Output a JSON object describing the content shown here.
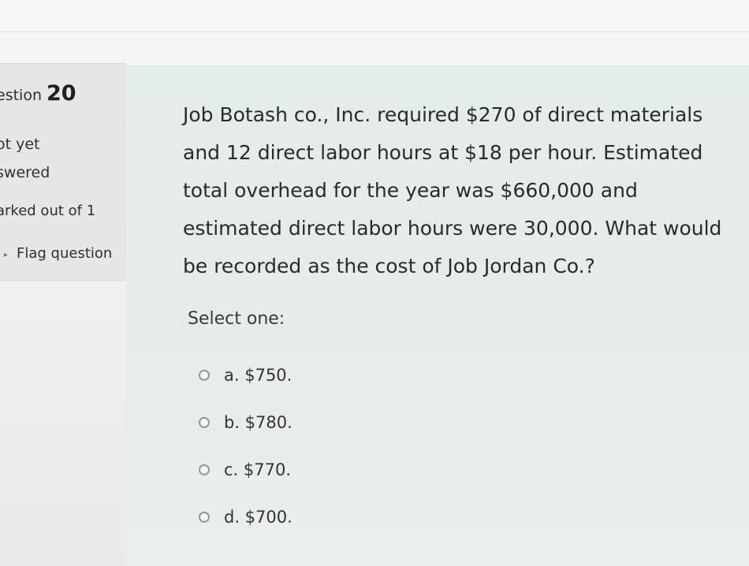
{
  "info": {
    "question_label": "estion",
    "question_number": "20",
    "state": "ot yet\nswered",
    "marks": "arked out of 1",
    "flag_label": "Flag question"
  },
  "question": {
    "text": "Job Botash co., Inc. required $270 of direct materials and 12 direct labor hours at $18 per hour. Estimated total overhead for the year was $660,000 and estimated direct labor hours were 30,000. What would be recorded as the cost of Job Jordan Co.?",
    "prompt": "Select one:",
    "answers": [
      {
        "label": "a. $750."
      },
      {
        "label": "b. $780."
      },
      {
        "label": "c. $770."
      },
      {
        "label": "d. $700."
      }
    ]
  }
}
